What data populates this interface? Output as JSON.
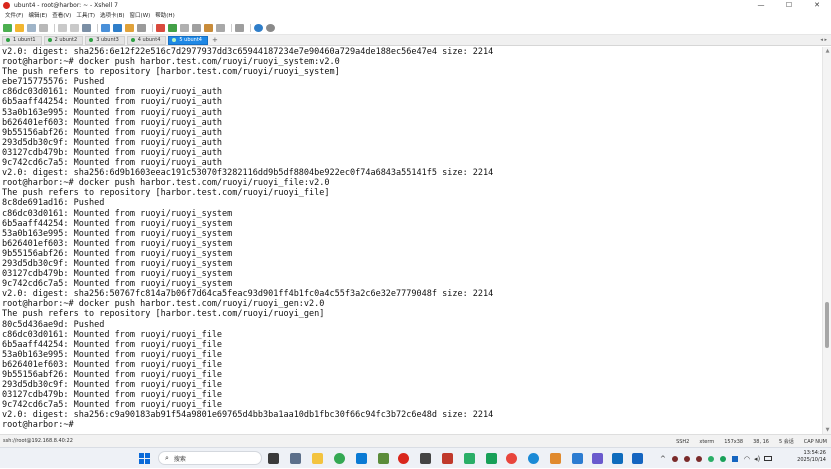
{
  "window": {
    "title": "ubunt4 - root@harbor: ~ - Xshell 7",
    "controls": [
      "—",
      "☐",
      "✕"
    ]
  },
  "menu": [
    "文件(F)",
    "编辑(E)",
    "查看(V)",
    "工具(T)",
    "选项卡(B)",
    "窗口(W)",
    "帮助(H)"
  ],
  "tabs": [
    {
      "label": "1 ubunt1",
      "active": false
    },
    {
      "label": "2 ubunt2",
      "active": false
    },
    {
      "label": "3 ubunt3",
      "active": false
    },
    {
      "label": "4 ubunt4",
      "active": false
    },
    {
      "label": "5 ubunt4",
      "active": true
    }
  ],
  "tab_add": "+",
  "terminal": {
    "lines": [
      "v2.0: digest: sha256:6e12f22e516c7d2977937dd3c65944187234e7e90460a729a4de188ec56e47e4 size: 2214",
      "root@harbor:~# docker push harbor.test.com/ruoyi/ruoyi_system:v2.0",
      "The push refers to repository [harbor.test.com/ruoyi/ruoyi_system]",
      "ebe715775576: Pushed",
      "c86dc03d0161: Mounted from ruoyi/ruoyi_auth",
      "6b5aaff44254: Mounted from ruoyi/ruoyi_auth",
      "53a0b163e995: Mounted from ruoyi/ruoyi_auth",
      "b626401ef603: Mounted from ruoyi/ruoyi_auth",
      "9b55156abf26: Mounted from ruoyi/ruoyi_auth",
      "293d5db30c9f: Mounted from ruoyi/ruoyi_auth",
      "03127cdb479b: Mounted from ruoyi/ruoyi_auth",
      "9c742cd6c7a5: Mounted from ruoyi/ruoyi_auth",
      "v2.0: digest: sha256:6d9b1603eeac191c53070f3282116dd9b5df8804be922ec0f74a6843a55141f5 size: 2214",
      "root@harbor:~# docker push harbor.test.com/ruoyi/ruoyi_file:v2.0",
      "The push refers to repository [harbor.test.com/ruoyi/ruoyi_file]",
      "8c8de691ad16: Pushed",
      "c86dc03d0161: Mounted from ruoyi/ruoyi_system",
      "6b5aaff44254: Mounted from ruoyi/ruoyi_system",
      "53a0b163e995: Mounted from ruoyi/ruoyi_system",
      "b626401ef603: Mounted from ruoyi/ruoyi_system",
      "9b55156abf26: Mounted from ruoyi/ruoyi_system",
      "293d5db30c9f: Mounted from ruoyi/ruoyi_system",
      "03127cdb479b: Mounted from ruoyi/ruoyi_system",
      "9c742cd6c7a5: Mounted from ruoyi/ruoyi_system",
      "v2.0: digest: sha256:50767fc814a7b06f7d64ca5feac93d901ff4b1fc0a4c55f3a2c6e32e7779048f size: 2214",
      "root@harbor:~# docker push harbor.test.com/ruoyi/ruoyi_gen:v2.0",
      "The push refers to repository [harbor.test.com/ruoyi/ruoyi_gen]",
      "80c5d436ae9d: Pushed",
      "c86dc03d0161: Mounted from ruoyi/ruoyi_file",
      "6b5aaff44254: Mounted from ruoyi/ruoyi_file",
      "53a0b163e995: Mounted from ruoyi/ruoyi_file",
      "b626401ef603: Mounted from ruoyi/ruoyi_file",
      "9b55156abf26: Mounted from ruoyi/ruoyi_file",
      "293d5db30c9f: Mounted from ruoyi/ruoyi_file",
      "03127cdb479b: Mounted from ruoyi/ruoyi_file",
      "9c742cd6c7a5: Mounted from ruoyi/ruoyi_file",
      "v2.0: digest: sha256:c9a90183ab91f54a9801e69765d4bb3ba1aa10db1fbc30f66c94fc3b72c6e48d size: 2214",
      "root@harbor:~#"
    ]
  },
  "status": {
    "connection": "ssh://root@192.168.8.40:22",
    "protocol": "SSH2",
    "terminal_type": "xterm",
    "size": "157x38",
    "cursor": "38, 16",
    "sessions": "5 会话",
    "caps": "CAP NUM"
  },
  "taskbar": {
    "search_placeholder": "搜索",
    "time": "13:54:26",
    "date": "2025/10/14"
  },
  "colors": {
    "tab_active": "#1e88e5",
    "terminal_bg": "#ffffff",
    "terminal_fg": "#111111"
  }
}
